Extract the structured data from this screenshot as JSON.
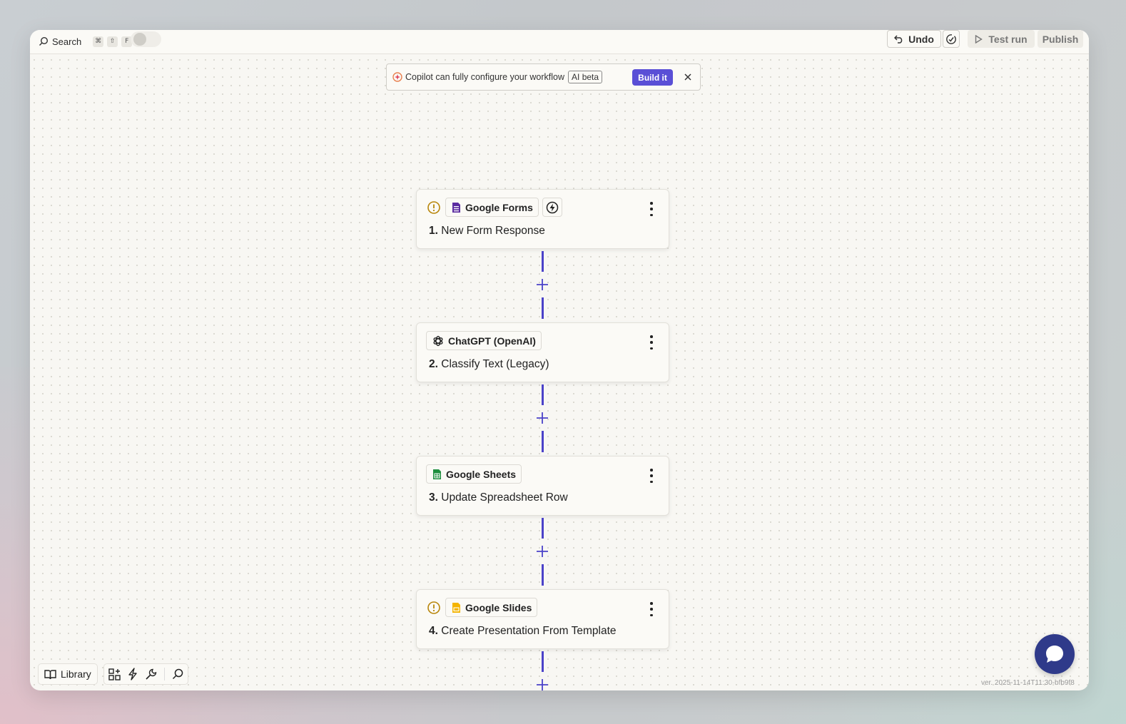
{
  "topbar": {
    "search_label": "Search",
    "search_shortcut": [
      "⌘",
      "⇧",
      "F"
    ],
    "undo_label": "Undo",
    "test_run_label": "Test run",
    "publish_label": "Publish"
  },
  "copilot_banner": {
    "text": "Copilot can fully configure your workflow",
    "tag": "AI beta",
    "button_label": "Build it"
  },
  "steps": [
    {
      "app": "Google Forms",
      "number": "1.",
      "title": "New Form Response",
      "warning": true,
      "trigger": true,
      "icon": "google-forms-icon",
      "color": "#5b2ca0"
    },
    {
      "app": "ChatGPT (OpenAI)",
      "number": "2.",
      "title": "Classify Text (Legacy)",
      "warning": false,
      "trigger": false,
      "icon": "openai-icon",
      "color": "#222222"
    },
    {
      "app": "Google Sheets",
      "number": "3.",
      "title": "Update Spreadsheet Row",
      "warning": false,
      "trigger": false,
      "icon": "google-sheets-icon",
      "color": "#1e8e3e"
    },
    {
      "app": "Google Slides",
      "number": "4.",
      "title": "Create Presentation From Template",
      "warning": true,
      "trigger": false,
      "icon": "google-slides-icon",
      "color": "#f4b400"
    }
  ],
  "bottom": {
    "library_label": "Library"
  },
  "version_text": "ver. 2025-11-14T11:30-bfb9f8",
  "colors": {
    "accent": "#5a4fd6",
    "connector": "#4b42c9",
    "warning": "#b8860b",
    "chat_button": "#2f3a8a"
  }
}
